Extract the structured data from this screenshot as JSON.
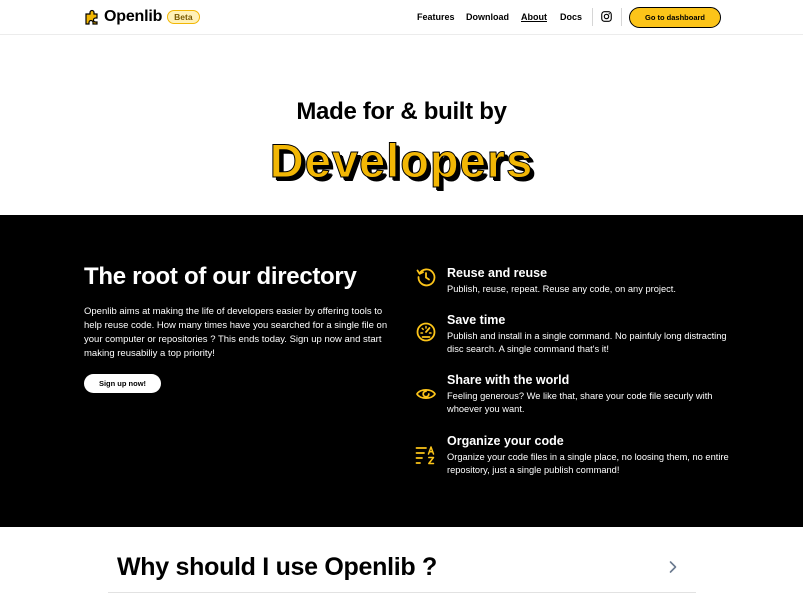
{
  "nav": {
    "brand": "Openlib",
    "badge": "Beta",
    "links": [
      "Features",
      "Download",
      "About",
      "Docs"
    ],
    "active_link": "About",
    "cta": "Go to dashboard"
  },
  "hero": {
    "line1": "Made for & built by",
    "line2": "Developers"
  },
  "directory": {
    "title": "The root of our directory",
    "text": "Openlib aims at making the life of developers easier by offering tools to help reuse code. How many times have you searched for a single file on your computer or repositories ? This ends today. Sign up now and start making reusabiliy a top priority!",
    "signup": "Sign up now!"
  },
  "features": [
    {
      "icon": "history-icon",
      "title": "Reuse and reuse",
      "text": "Publish, reuse, repeat. Reuse any code, on any project."
    },
    {
      "icon": "speedometer-icon",
      "title": "Save time",
      "text": "Publish and install in a single command. No painfuly long distracting disc search. A single command that's it!"
    },
    {
      "icon": "eye-icon",
      "title": "Share with the world",
      "text": "Feeling generous? We like that, share your code file securly with whoever you want."
    },
    {
      "icon": "sort-az-icon",
      "title": "Organize your code",
      "text": "Organize your code files in a single place, no loosing them, no entire repository, just a single publish command!"
    }
  ],
  "why": {
    "title": "Why should I use Openlib ?"
  },
  "colors": {
    "accent": "#fcc419",
    "accent_dark": "#f2b705",
    "dark_bg": "#000000"
  }
}
